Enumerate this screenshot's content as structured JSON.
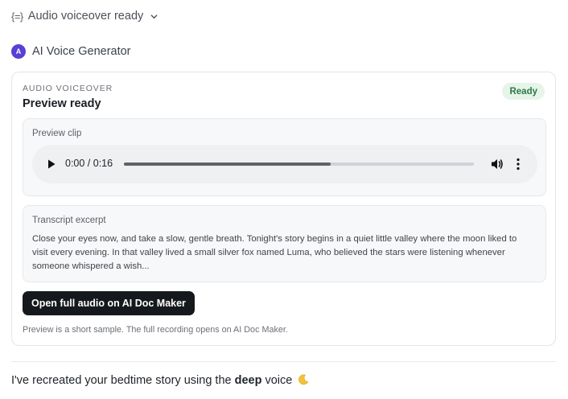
{
  "status": {
    "label": "Audio voiceover ready",
    "icon": "braces-icon",
    "braces_glyph": "{=}"
  },
  "agent": {
    "name": "AI Voice Generator",
    "avatar_letter": "A",
    "avatar_color": "#5a3fd6"
  },
  "card": {
    "eyebrow": "AUDIO VOICEOVER",
    "title": "Preview ready",
    "badge": "Ready",
    "preview": {
      "label": "Preview clip",
      "time": "0:00 / 0:16",
      "progress_fraction": 0.59
    },
    "transcript": {
      "label": "Transcript excerpt",
      "text": "Close your eyes now, and take a slow, gentle breath. Tonight's story begins in a quiet little valley where the moon liked to visit every evening. In that valley lived a small silver fox named Luma, who believed the stars were listening whenever someone whispered a wish..."
    },
    "button_label": "Open full audio on AI Doc Maker",
    "footnote": "Preview is a short sample. The full recording opens on AI Doc Maker."
  },
  "message": {
    "before": "I've recreated your bedtime story using the ",
    "emphasis": "deep",
    "after": " voice",
    "emoji_icon": "crescent-moon-icon"
  },
  "colors": {
    "badge_bg": "#e6f4ea",
    "badge_text": "#2c7a42",
    "button_bg": "#15181d"
  }
}
